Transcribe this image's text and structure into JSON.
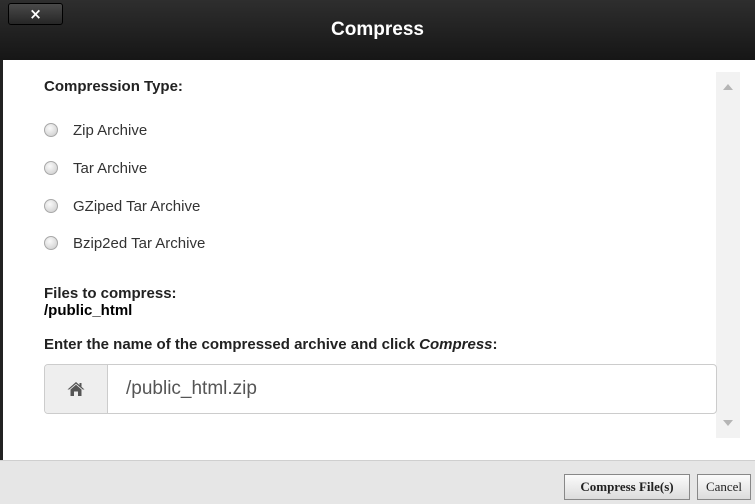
{
  "dialog": {
    "title": "Compress",
    "close_label": "×"
  },
  "compression": {
    "heading": "Compression Type:",
    "options": [
      {
        "label": "Zip Archive",
        "selected": false
      },
      {
        "label": "Tar Archive",
        "selected": false
      },
      {
        "label": "GZiped Tar Archive",
        "selected": false
      },
      {
        "label": "Bzip2ed Tar Archive",
        "selected": false
      }
    ]
  },
  "files": {
    "heading": "Files to compress:",
    "path": "/public_html"
  },
  "archive": {
    "instruction_prefix": "Enter the name of the compressed archive and click ",
    "instruction_emphasis": "Compress",
    "instruction_suffix": ":",
    "value": "/public_html.zip",
    "icon": "home-icon"
  },
  "footer": {
    "compress_label": "Compress File(s)",
    "cancel_label": "Cancel"
  }
}
